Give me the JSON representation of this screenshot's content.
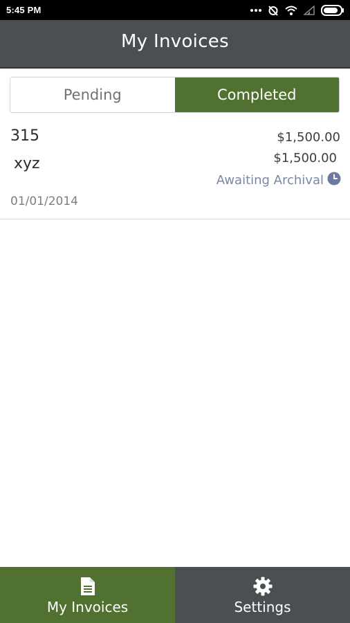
{
  "status_bar": {
    "time": "5:45 PM",
    "icons": [
      "more-dots-icon",
      "alarm-off-icon",
      "wifi-icon",
      "signal-icon",
      "battery-icon"
    ]
  },
  "header": {
    "title": "My Invoices"
  },
  "tabs": [
    {
      "label": "Pending",
      "selected": false
    },
    {
      "label": "Completed",
      "selected": true
    }
  ],
  "invoices": [
    {
      "number": "315",
      "customer": "xyz",
      "date": "01/01/2014",
      "total": "$1,500.00",
      "balance": "$1,500.00",
      "status": "Awaiting Archival",
      "status_icon": "clock-icon"
    }
  ],
  "bottom_nav": {
    "items": [
      {
        "label": "My Invoices",
        "icon": "document-icon",
        "active": true
      },
      {
        "label": "Settings",
        "icon": "gear-icon",
        "active": false
      }
    ]
  },
  "colors": {
    "accent_green": "#50712f",
    "header_gray": "#4a5051",
    "status_text": "#7a86a6"
  }
}
